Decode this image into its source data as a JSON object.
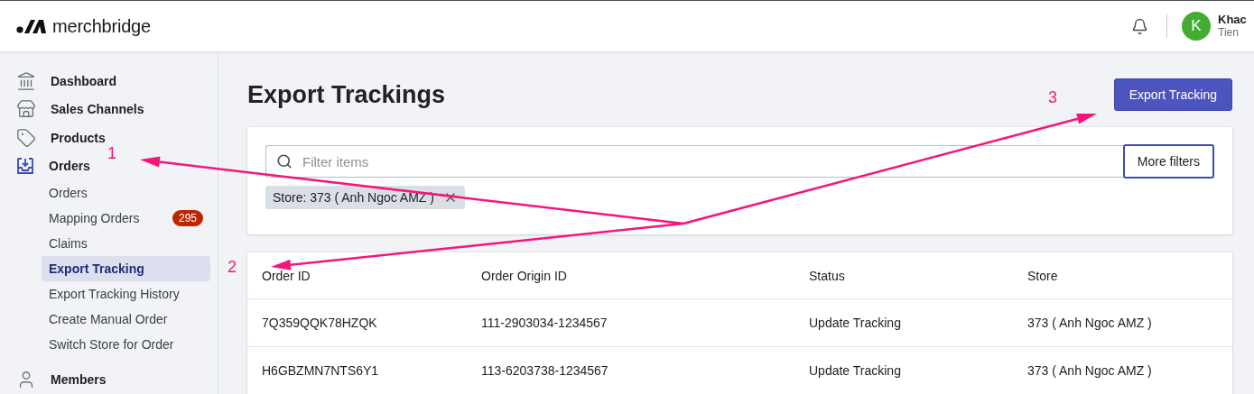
{
  "brand": {
    "name": "merchbridge"
  },
  "user": {
    "initial": "K",
    "first_name": "Khac",
    "last_name": "Tien"
  },
  "sidebar": {
    "items": [
      {
        "label": "Dashboard",
        "selected": false
      },
      {
        "label": "Sales Channels",
        "selected": false
      },
      {
        "label": "Products",
        "selected": false
      },
      {
        "label": "Orders",
        "selected": true,
        "children": [
          {
            "label": "Orders",
            "selected": false
          },
          {
            "label": "Mapping Orders",
            "selected": false,
            "badge": "295"
          },
          {
            "label": "Claims",
            "selected": false
          },
          {
            "label": "Export Tracking",
            "selected": true
          },
          {
            "label": "Export Tracking History",
            "selected": false
          },
          {
            "label": "Create Manual Order",
            "selected": false
          },
          {
            "label": "Switch Store for Order",
            "selected": false
          }
        ]
      },
      {
        "label": "Members",
        "selected": false
      }
    ]
  },
  "page": {
    "title": "Export Trackings",
    "primary_button": "Export Tracking",
    "filter": {
      "placeholder": "Filter items",
      "more_button": "More filters",
      "chips": [
        {
          "label": "Store: 373 ( Anh Ngoc AMZ )"
        }
      ]
    },
    "table": {
      "columns": [
        "Order ID",
        "Order Origin ID",
        "Status",
        "Store"
      ],
      "rows": [
        [
          "7Q359QQK78HZQK",
          "111-2903034-1234567",
          "Update Tracking",
          "373 ( Anh Ngoc AMZ )"
        ],
        [
          "H6GBZMN7NTS6Y1",
          "113-6203738-1234567",
          "Update Tracking",
          "373 ( Anh Ngoc AMZ )"
        ]
      ]
    }
  },
  "annotations": [
    {
      "label": "1"
    },
    {
      "label": "2"
    },
    {
      "label": "3"
    }
  ]
}
